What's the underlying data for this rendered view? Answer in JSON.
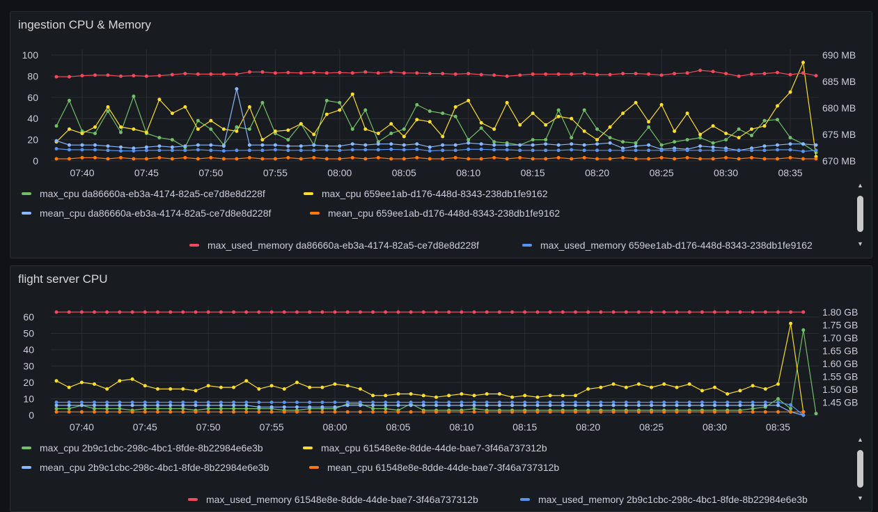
{
  "colors": {
    "green": "#73bf69",
    "yellow": "#fade2a",
    "blue_light": "#8ab8ff",
    "orange": "#ff780a",
    "red": "#f2495c",
    "blue": "#5794f2",
    "grid": "#2a2d33",
    "axis_text": "#ccccdc"
  },
  "panels": [
    {
      "title": "ingestion CPU & Memory",
      "legend": [
        {
          "label": "max_cpu da86660a-eb3a-4174-82a5-ce7d8e8d228f",
          "color": "#73bf69"
        },
        {
          "label": "max_cpu 659ee1ab-d176-448d-8343-238db1fe9162",
          "color": "#fade2a"
        },
        {
          "label": "mean_cpu da86660a-eb3a-4174-82a5-ce7d8e8d228f",
          "color": "#8ab8ff"
        },
        {
          "label": "mean_cpu 659ee1ab-d176-448d-8343-238db1fe9162",
          "color": "#ff780a"
        },
        {
          "label": "max_used_memory da86660a-eb3a-4174-82a5-ce7d8e8d228f",
          "color": "#f2495c"
        },
        {
          "label": "max_used_memory 659ee1ab-d176-448d-8343-238db1fe9162",
          "color": "#5794f2"
        }
      ]
    },
    {
      "title": "flight server CPU",
      "legend": [
        {
          "label": "max_cpu 2b9c1cbc-298c-4bc1-8fde-8b22984e6e3b",
          "color": "#73bf69"
        },
        {
          "label": "max_cpu 61548e8e-8dde-44de-bae7-3f46a737312b",
          "color": "#fade2a"
        },
        {
          "label": "mean_cpu 2b9c1cbc-298c-4bc1-8fde-8b22984e6e3b",
          "color": "#8ab8ff"
        },
        {
          "label": "mean_cpu 61548e8e-8dde-44de-bae7-3f46a737312b",
          "color": "#ff780a"
        },
        {
          "label": "max_used_memory 61548e8e-8dde-44de-bae7-3f46a737312b",
          "color": "#f2495c"
        },
        {
          "label": "max_used_memory 2b9c1cbc-298c-4bc1-8fde-8b22984e6e3b",
          "color": "#5794f2"
        }
      ]
    }
  ],
  "chart_data": [
    {
      "type": "line",
      "title": "ingestion CPU & Memory",
      "x_tick_labels": [
        "07:40",
        "07:45",
        "07:50",
        "07:55",
        "08:00",
        "08:05",
        "08:10",
        "08:15",
        "08:20",
        "08:25",
        "08:30",
        "08:35"
      ],
      "x_range_minutes": [
        0,
        59
      ],
      "y_left": {
        "ticks": [
          "0",
          "20",
          "40",
          "60",
          "80",
          "100"
        ],
        "ylim": [
          0,
          100
        ]
      },
      "y_right": {
        "ticks": [
          "670 MB",
          "675 MB",
          "680 MB",
          "685 MB",
          "690 MB"
        ],
        "ylim": [
          670,
          690
        ],
        "unit": "MB"
      },
      "grid": true,
      "legend_position": "bottom",
      "series": [
        {
          "name": "max_cpu da86660a-eb3a-4174-82a5-ce7d8e8d228f",
          "axis": "left",
          "color": "#73bf69",
          "values": [
            33,
            57,
            28,
            26,
            47,
            27,
            61,
            26,
            22,
            20,
            13,
            38,
            30,
            15,
            32,
            30,
            55,
            26,
            20,
            35,
            15,
            57,
            55,
            30,
            48,
            18,
            26,
            30,
            53,
            47,
            45,
            42,
            20,
            31,
            18,
            17,
            15,
            20,
            20,
            48,
            22,
            48,
            30,
            22,
            18,
            17,
            32,
            15,
            18,
            20,
            22,
            17,
            20,
            30,
            24,
            38,
            39,
            22,
            16,
            8
          ]
        },
        {
          "name": "max_cpu 659ee1ab-d176-448d-8343-238db1fe9162",
          "axis": "left",
          "color": "#fade2a",
          "values": [
            18,
            30,
            26,
            32,
            51,
            32,
            30,
            27,
            58,
            45,
            51,
            30,
            38,
            30,
            28,
            51,
            20,
            28,
            29,
            35,
            25,
            44,
            48,
            63,
            30,
            26,
            35,
            23,
            39,
            37,
            23,
            51,
            57,
            36,
            30,
            55,
            34,
            45,
            34,
            42,
            40,
            28,
            20,
            32,
            45,
            55,
            37,
            53,
            28,
            45,
            25,
            33,
            26,
            22,
            30,
            33,
            52,
            65,
            93,
            4
          ]
        },
        {
          "name": "mean_cpu da86660a-eb3a-4174-82a5-ce7d8e8d228f",
          "axis": "left",
          "color": "#8ab8ff",
          "values": [
            19,
            15,
            15,
            15,
            14,
            13,
            12,
            13,
            14,
            13,
            14,
            15,
            15,
            14,
            68,
            15,
            15,
            15,
            14,
            14,
            15,
            14,
            14,
            16,
            15,
            16,
            16,
            15,
            16,
            13,
            15,
            15,
            17,
            16,
            15,
            15,
            15,
            15,
            16,
            15,
            16,
            15,
            16,
            17,
            12,
            14,
            15,
            11,
            12,
            11,
            14,
            13,
            12,
            10,
            12,
            14,
            15,
            16,
            16,
            15
          ]
        },
        {
          "name": "mean_cpu 659ee1ab-d176-448d-8343-238db1fe9162",
          "axis": "left",
          "color": "#ff780a",
          "values": [
            2,
            2,
            3,
            3,
            2,
            3,
            2,
            2,
            3,
            2,
            3,
            2,
            3,
            2,
            2,
            3,
            2,
            2,
            3,
            2,
            3,
            2,
            2,
            3,
            2,
            3,
            2,
            2,
            3,
            2,
            2,
            3,
            2,
            2,
            3,
            2,
            3,
            2,
            2,
            3,
            2,
            3,
            2,
            2,
            3,
            2,
            2,
            3,
            2,
            3,
            2,
            2,
            3,
            2,
            3,
            2,
            2,
            3,
            2,
            2
          ]
        },
        {
          "name": "max_used_memory da86660a-eb3a-4174-82a5-ce7d8e8d228f",
          "axis": "right",
          "color": "#f2495c",
          "values": [
            685.9,
            685.9,
            686.1,
            686.2,
            686.2,
            686.0,
            686.1,
            686.0,
            686.1,
            686.3,
            686.5,
            686.4,
            686.4,
            686.4,
            686.4,
            686.8,
            686.8,
            686.6,
            686.7,
            686.6,
            686.7,
            686.6,
            686.7,
            686.6,
            686.8,
            686.6,
            686.8,
            686.6,
            686.6,
            686.5,
            686.5,
            686.4,
            686.5,
            686.3,
            686.2,
            686.0,
            686.2,
            686.4,
            686.4,
            686.4,
            686.4,
            686.5,
            686.3,
            686.3,
            686.5,
            686.5,
            686.4,
            686.2,
            686.5,
            686.6,
            687.1,
            686.9,
            686.5,
            686.0,
            686.4,
            686.5,
            686.7,
            686.3,
            686.6,
            686.1
          ]
        },
        {
          "name": "max_used_memory 659ee1ab-d176-448d-8343-238db1fe9162",
          "axis": "right",
          "color": "#5794f2",
          "values": [
            672.3,
            672.1,
            672.1,
            672.1,
            672.0,
            671.9,
            671.9,
            672.0,
            672.0,
            672.0,
            672.0,
            672.1,
            672.0,
            671.9,
            672.0,
            672.0,
            672.0,
            672.1,
            672.0,
            672.0,
            672.0,
            672.1,
            672.0,
            672.1,
            672.1,
            672.1,
            672.2,
            672.1,
            672.2,
            671.9,
            672.0,
            672.0,
            672.2,
            672.2,
            672.1,
            672.1,
            672.0,
            672.0,
            672.0,
            672.0,
            672.1,
            672.0,
            672.0,
            672.0,
            672.0,
            672.0,
            672.0,
            672.0,
            672.0,
            672.0,
            672.0,
            672.0,
            672.0,
            672.0,
            672.0,
            672.0,
            672.1,
            672.1,
            671.8,
            672.0
          ]
        }
      ]
    },
    {
      "type": "line",
      "title": "flight server CPU",
      "x_tick_labels": [
        "07:40",
        "07:45",
        "07:50",
        "07:55",
        "08:00",
        "08:05",
        "08:10",
        "08:15",
        "08:20",
        "08:25",
        "08:30",
        "08:35"
      ],
      "x_range_minutes": [
        0,
        59
      ],
      "y_left": {
        "ticks": [
          "0",
          "10",
          "20",
          "30",
          "40",
          "50",
          "60"
        ],
        "ylim": [
          0,
          63
        ]
      },
      "y_right": {
        "ticks": [
          "1.45 GB",
          "1.50 GB",
          "1.55 GB",
          "1.60 GB",
          "1.65 GB",
          "1.70 GB",
          "1.75 GB",
          "1.80 GB"
        ],
        "ylim": [
          1.4,
          1.8
        ],
        "unit": "GB"
      },
      "grid": true,
      "legend_position": "bottom",
      "series": [
        {
          "name": "max_cpu 2b9c1cbc-298c-4bc1-8fde-8b22984e6e3b",
          "axis": "left",
          "color": "#73bf69",
          "values": [
            4,
            4,
            6,
            4,
            4,
            4,
            3,
            4,
            4,
            4,
            4,
            3,
            4,
            4,
            4,
            4,
            4,
            4,
            3,
            3,
            4,
            4,
            4,
            7,
            7,
            4,
            4,
            3,
            7,
            3,
            3,
            3,
            3,
            4,
            3,
            3,
            3,
            3,
            3,
            3,
            3,
            3,
            3,
            3,
            3,
            3,
            3,
            3,
            3,
            3,
            3,
            3,
            3,
            3,
            3,
            4,
            5,
            10,
            4,
            52,
            1
          ]
        },
        {
          "name": "max_cpu 61548e8e-8dde-44de-bae7-3f46a737312b",
          "axis": "left",
          "color": "#fade2a",
          "values": [
            21,
            17,
            20,
            19,
            16,
            21,
            22,
            18,
            16,
            16,
            16,
            15,
            18,
            17,
            17,
            21,
            16,
            18,
            16,
            20,
            17,
            17,
            19,
            18,
            16,
            12,
            12,
            13,
            13,
            12,
            11,
            12,
            13,
            12,
            13,
            13,
            11,
            12,
            11,
            12,
            12,
            12,
            16,
            17,
            19,
            17,
            19,
            17,
            19,
            17,
            19,
            15,
            17,
            13,
            15,
            18,
            16,
            19,
            56,
            2
          ]
        },
        {
          "name": "mean_cpu 2b9c1cbc-298c-4bc1-8fde-8b22984e6e3b",
          "axis": "left",
          "color": "#8ab8ff",
          "values": [
            6,
            6,
            6,
            6,
            6,
            6,
            6,
            6,
            6,
            6,
            6,
            6,
            6,
            6,
            6,
            6,
            5,
            5,
            5,
            5,
            5,
            5,
            5,
            6,
            6,
            6,
            6,
            6,
            6,
            6,
            6,
            6,
            6,
            6,
            6,
            6,
            6,
            6,
            6,
            6,
            6,
            6,
            6,
            6,
            6,
            6,
            6,
            6,
            6,
            6,
            6,
            6,
            6,
            6,
            6,
            6,
            6,
            6,
            2,
            0
          ]
        },
        {
          "name": "mean_cpu 61548e8e-8dde-44de-bae7-3f46a737312b",
          "axis": "left",
          "color": "#ff780a",
          "values": [
            2,
            2,
            2,
            2,
            2,
            2,
            2,
            2,
            2,
            2,
            2,
            2,
            2,
            2,
            2,
            2,
            2,
            2,
            2,
            2,
            2,
            2,
            2,
            2,
            2,
            2,
            2,
            2,
            2,
            2,
            2,
            2,
            2,
            2,
            2,
            2,
            2,
            2,
            2,
            2,
            2,
            2,
            2,
            2,
            2,
            2,
            2,
            2,
            2,
            2,
            2,
            2,
            2,
            2,
            2,
            2,
            2,
            2,
            2,
            2
          ]
        },
        {
          "name": "max_used_memory 61548e8e-8dde-44de-bae7-3f46a737312b",
          "axis": "right",
          "color": "#f2495c",
          "values": [
            1.8,
            1.8,
            1.8,
            1.8,
            1.8,
            1.8,
            1.8,
            1.8,
            1.8,
            1.8,
            1.8,
            1.8,
            1.8,
            1.8,
            1.8,
            1.8,
            1.8,
            1.8,
            1.8,
            1.8,
            1.8,
            1.8,
            1.8,
            1.8,
            1.8,
            1.8,
            1.8,
            1.8,
            1.8,
            1.8,
            1.8,
            1.8,
            1.8,
            1.8,
            1.8,
            1.8,
            1.8,
            1.8,
            1.8,
            1.8,
            1.8,
            1.8,
            1.8,
            1.8,
            1.8,
            1.8,
            1.8,
            1.8,
            1.8,
            1.8,
            1.8,
            1.8,
            1.8,
            1.8,
            1.8,
            1.8,
            1.8,
            1.8,
            1.8,
            1.8
          ]
        },
        {
          "name": "max_used_memory 2b9c1cbc-298c-4bc1-8fde-8b22984e6e3b",
          "axis": "right",
          "color": "#5794f2",
          "values": [
            1.45,
            1.45,
            1.45,
            1.45,
            1.45,
            1.45,
            1.45,
            1.45,
            1.45,
            1.45,
            1.45,
            1.45,
            1.45,
            1.45,
            1.45,
            1.45,
            1.45,
            1.45,
            1.45,
            1.45,
            1.45,
            1.45,
            1.45,
            1.45,
            1.45,
            1.45,
            1.45,
            1.45,
            1.45,
            1.45,
            1.45,
            1.45,
            1.45,
            1.45,
            1.45,
            1.45,
            1.45,
            1.45,
            1.45,
            1.45,
            1.45,
            1.45,
            1.45,
            1.45,
            1.45,
            1.45,
            1.45,
            1.45,
            1.45,
            1.45,
            1.45,
            1.45,
            1.45,
            1.45,
            1.45,
            1.45,
            1.45,
            1.45,
            1.44,
            1.4
          ]
        }
      ]
    }
  ]
}
